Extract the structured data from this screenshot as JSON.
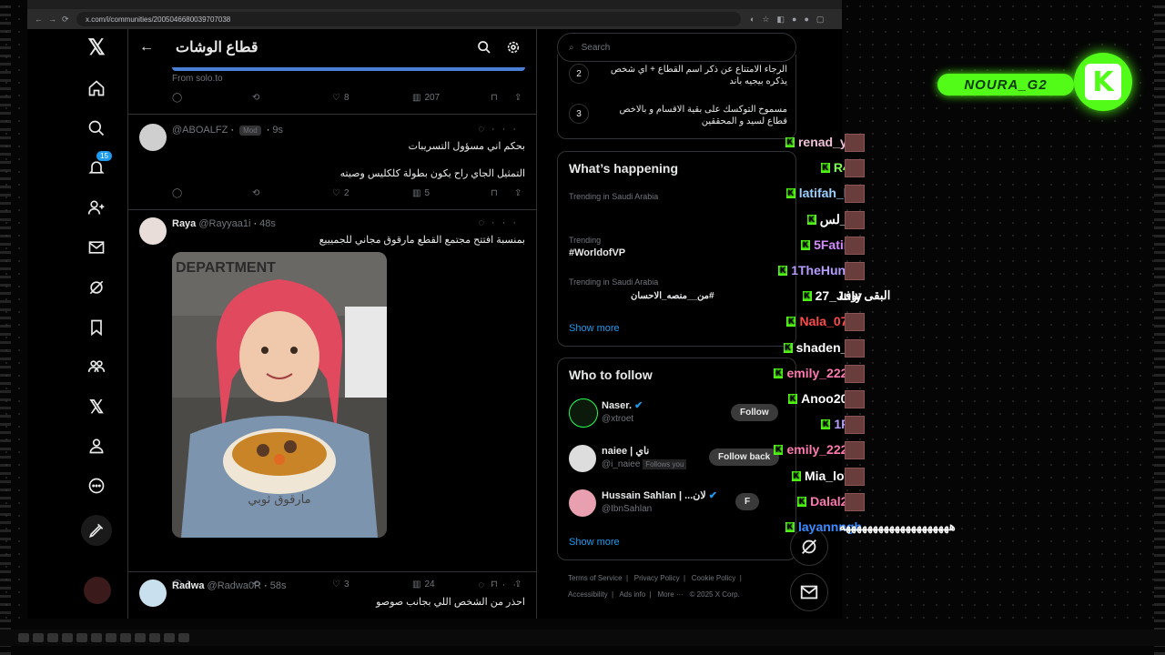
{
  "browser": {
    "url": "x.com/i/communities/2005046680039707038"
  },
  "header": {
    "title": "قطاع الوشات",
    "back_label": "←"
  },
  "nav": {
    "notif_count": "15"
  },
  "tweets": [
    {
      "source": "From solo.to",
      "replies": "",
      "retweets": "",
      "likes": "8",
      "views": "207"
    },
    {
      "name": "",
      "handle": "@ABOALFZ",
      "tag": "Mod",
      "time": "9s",
      "line1": "بحكم اني مسؤول التسريبات",
      "line2": "التمثيل الجاي راح يكون بطولة كلكليس وصيته",
      "replies": "",
      "likes": "2",
      "views": "5"
    },
    {
      "name": "Raya",
      "handle": "@Rayyaa1i",
      "time": "48s",
      "line1": "بمنسبة افتتح مجتمع القطع مارقوق مجاني للجميييع",
      "replies": "1",
      "likes": "3",
      "views": "24",
      "image_caption": "مارقوق ثوبي",
      "image_sign": "DEPARTMENT"
    },
    {
      "name": "Radwa",
      "handle": "@Radwa0R",
      "time": "58s",
      "line1": "احذر من الشخص اللي بجانب صوصو"
    }
  ],
  "right": {
    "search_placeholder": "Search",
    "rules": [
      {
        "num": "2",
        "text": "الرجاء الامتناع عن ذكر اسم القطاع + اي شخص يذكره بيجيه باند"
      },
      {
        "num": "3",
        "text": "مسموح التوكسك على بقية الاقسام و بالاخص قطاع لسيد و المحققين"
      }
    ],
    "happening": {
      "title": "What’s happening",
      "t1_context": "Trending in Saudi Arabia",
      "t2_context": "Trending",
      "t2_tag": "#WorldofVP",
      "t3_context": "Trending in Saudi Arabia",
      "t3_tag": "#من__منصه_الاحسان",
      "more": "Show more"
    },
    "follow": {
      "title": "Who to follow",
      "users": [
        {
          "name": "Naser.",
          "handle": "@xtroet",
          "btn": "Follow"
        },
        {
          "name": "naiee | ناي",
          "handle": "@i_naiee",
          "follows_you": "Follows you",
          "btn": "Follow back"
        },
        {
          "name": "Hussain Sahlan | ...لان",
          "handle": "@IbnSahlan",
          "btn": "F"
        }
      ],
      "more": "Show more"
    },
    "footer": {
      "l1": [
        "Terms of Service",
        "Privacy Policy",
        "Cookie Policy"
      ],
      "l2": [
        "Accessibility",
        "Ads info",
        "More ···",
        "© 2025 X Corp."
      ]
    }
  },
  "chat": [
    {
      "user": "renad_yoy",
      "color": "#f0c0d8"
    },
    {
      "user": "R4fif",
      "color": "#7cff4a"
    },
    {
      "user": "latifah_luv",
      "color": "#9ad0ff"
    },
    {
      "user": "ق_لس*",
      "color": "#ffffff"
    },
    {
      "user": "5Fatima",
      "color": "#d58cff"
    },
    {
      "user": "1TheHunter",
      "color": "#b69cff"
    },
    {
      "user": "27_July",
      "color": "#ffffff",
      "msg": "البقى نوف"
    },
    {
      "user": "Nala_0705",
      "color": "#ff4a4a"
    },
    {
      "user": "shaden_52",
      "color": "#ffffff"
    },
    {
      "user": "emily_22223",
      "color": "#ff79b0"
    },
    {
      "user": "Anoo2005",
      "color": "#ffffff"
    },
    {
      "user": "1RYI",
      "color": "#b69cff"
    },
    {
      "user": "emily_22223",
      "color": "#ff79b0"
    },
    {
      "user": "Mia_lovly",
      "color": "#ffffff"
    },
    {
      "user": "Dalal225",
      "color": "#ff79b0"
    },
    {
      "user": "layannngh",
      "color": "#3a8bff",
      "msg": "ههههههههههههههههههههه"
    }
  ],
  "overlay": {
    "streamer": "NOURA_G2",
    "kick_letter": "K"
  }
}
